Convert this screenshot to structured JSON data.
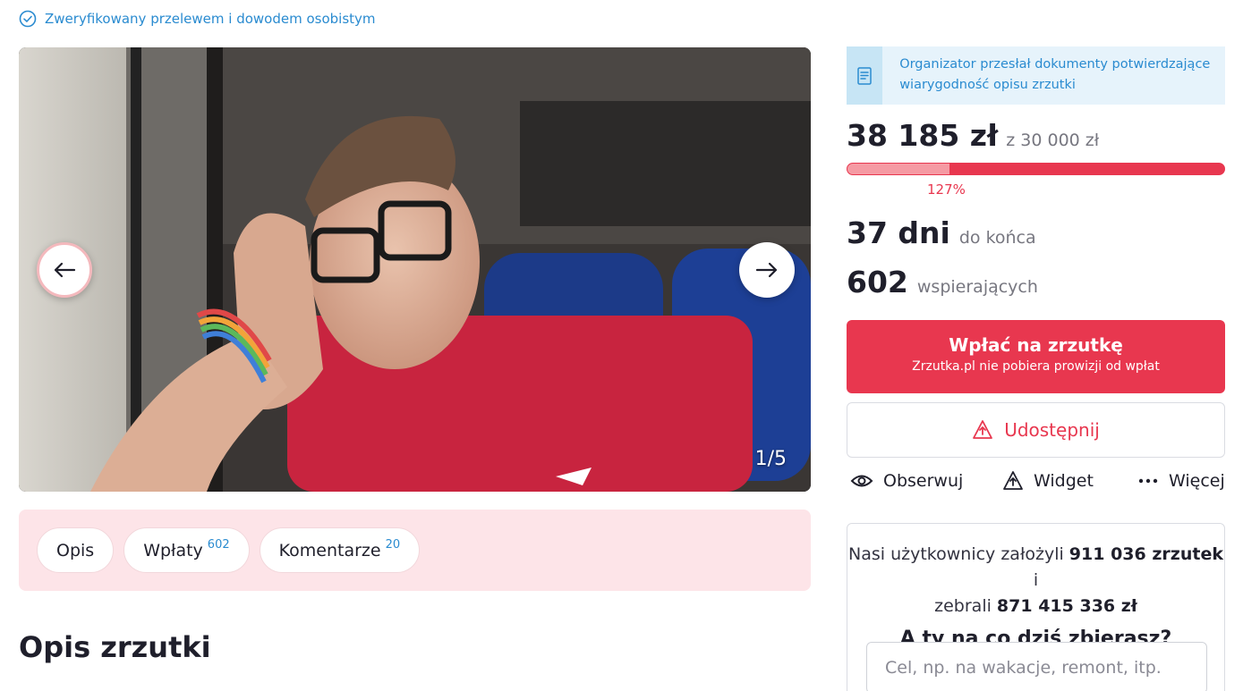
{
  "verification": {
    "text": "Zweryfikowany przelewem i dowodem osobistym",
    "icon": "check-circle-icon"
  },
  "gallery": {
    "counter": "1/5",
    "prev_icon": "arrow-left-icon",
    "next_icon": "arrow-right-icon"
  },
  "tabs": [
    {
      "label": "Opis",
      "count": ""
    },
    {
      "label": "Wpłaty",
      "count": "602"
    },
    {
      "label": "Komentarze",
      "count": "20"
    }
  ],
  "section_title": "Opis zrzutki",
  "documents_notice": {
    "text": "Organizator przesłał dokumenty potwierdzające wiarygodność opisu zrzutki",
    "icon": "document-icon"
  },
  "funding": {
    "raised": "38 185 zł",
    "goal": "z 30 000 zł",
    "percent_label": "127%",
    "progress_fraction": 0.27
  },
  "days": {
    "value": "37 dni",
    "label": "do końca"
  },
  "supporters": {
    "value": "602",
    "label": "wspierających"
  },
  "donate_button": {
    "label": "Wpłać na zrzutkę",
    "sublabel": "Zrzutka.pl nie pobiera prowizji od wpłat"
  },
  "share_button": {
    "label": "Udostępnij",
    "icon": "share-icon"
  },
  "actions": [
    {
      "label": "Obserwuj",
      "icon": "eye-icon"
    },
    {
      "label": "Widget",
      "icon": "widget-icon"
    },
    {
      "label": "Więcej",
      "icon": "more-dots-icon"
    }
  ],
  "promo": {
    "line1_prefix": "Nasi użytkownicy założyli ",
    "line1_count": "911 036 zrzutek",
    "line1_suffix": " i",
    "line2_prefix": "zebrali ",
    "line2_amount": "871 415 336 zł",
    "question": "A ty na co dziś zbierasz?",
    "input_placeholder": "Cel, np. na wakacje, remont, itp."
  },
  "colors": {
    "brand_red": "#e8374f",
    "progress_light": "#f59aa3",
    "info_blue": "#2a8bd0",
    "tabs_bg": "#fde4e8",
    "notice_bg": "#e6f3fb"
  }
}
